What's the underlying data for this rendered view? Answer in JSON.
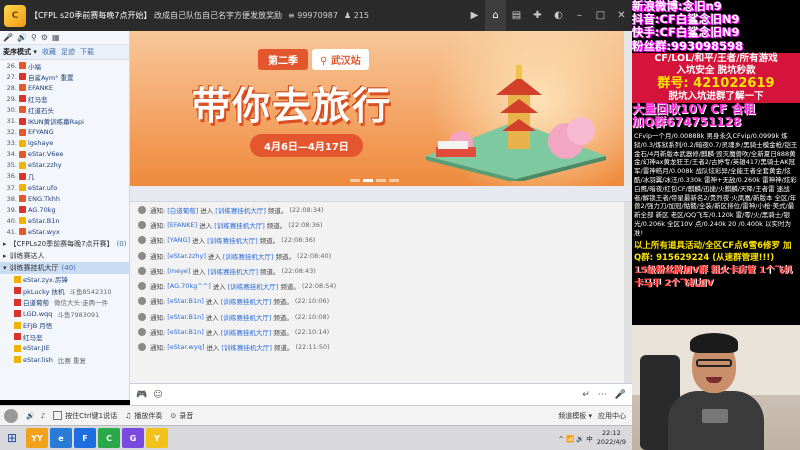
{
  "titlebar": {
    "logo": "C",
    "channel": "【CFPL s20季前赛每晚7点开始】",
    "announcement": "改成自己队伍自己名字方便发放奖励",
    "id_prefix": "≡",
    "id": "99970987",
    "users_icon": "♟",
    "users": "215",
    "icons": [
      "record-icon",
      "home-icon",
      "list-icon",
      "gamepad-icon",
      "skin-icon",
      "min-icon",
      "max-icon",
      "close-icon"
    ]
  },
  "leftpane": {
    "toolbar_label": "麦序模式 ▾",
    "tabs": [
      {
        "label": "频道",
        "selected": true
      },
      {
        "label": "收藏",
        "selected": false
      },
      {
        "label": "足迹",
        "selected": false
      },
      {
        "label": "下载",
        "selected": false
      }
    ],
    "users": [
      {
        "num": "26.",
        "name": "小福"
      },
      {
        "num": "27.",
        "name": "自鲨Aym° 重置"
      },
      {
        "num": "28.",
        "name": "EFANKE"
      },
      {
        "num": "29.",
        "name": "红马悲"
      },
      {
        "num": "30.",
        "name": "红道石头"
      },
      {
        "num": "31.",
        "name": "IKUN黄训练幕Rapi"
      },
      {
        "num": "32.",
        "name": "EFYANG"
      },
      {
        "num": "33.",
        "name": "lgshaye"
      },
      {
        "num": "34.",
        "name": "eStar.V6ee"
      },
      {
        "num": "35.",
        "name": "eStar.zzhy"
      },
      {
        "num": "36.",
        "name": "几"
      },
      {
        "num": "37.",
        "name": "eStar.ufo"
      },
      {
        "num": "38.",
        "name": "ENG.Tkhh"
      },
      {
        "num": "39.",
        "name": "AG.70kg"
      },
      {
        "num": "40.",
        "name": "eStar.B1n"
      },
      {
        "num": "41.",
        "name": "eStar.wyx"
      }
    ],
    "channels": [
      {
        "name": "【CFPLs20季前赛每晚7点开赛】",
        "count": "(0)",
        "highlight": false
      },
      {
        "name": "训练赛达人",
        "count": "",
        "highlight": false
      },
      {
        "name": "训练赛挂机大厅",
        "count": "(40)",
        "highlight": true
      }
    ],
    "subusers": [
      {
        "name": "eStar.zyx.厉锋",
        "extra": ""
      },
      {
        "name": "pkLucky 扶机",
        "extra": "斗鱼8542310"
      },
      {
        "name": "白道葡萄",
        "extra": "微信大头·走两一件"
      },
      {
        "name": "LGD.wqq",
        "extra": "斗鱼7983091"
      },
      {
        "name": "EFJB 月悟",
        "extra": ""
      },
      {
        "name": "红马悲",
        "extra": ""
      },
      {
        "name": "eStar.JIE",
        "extra": ""
      },
      {
        "name": "eStar.lish",
        "extra": "比赛 重复"
      }
    ]
  },
  "banner": {
    "season": "第二季",
    "city": "武汉站",
    "slogan": "带你去旅行",
    "dates": "4月6日—4月17日"
  },
  "chat": {
    "label": "通知:",
    "action": "进入",
    "room": "[训练赛挂机大厅]",
    "suffix": "频道。",
    "messages": [
      {
        "user": "[白道葡萄]",
        "time": "(22:08:34)"
      },
      {
        "user": "[EFANKE]",
        "time": "(22:08:36)"
      },
      {
        "user": "[YANG]",
        "time": "(22:08:36)"
      },
      {
        "user": "[eStar.zzhy]",
        "time": "(22:08:40)"
      },
      {
        "user": "[meye]",
        "time": "(22:08:43)"
      },
      {
        "user": "[AG.70kg^^]",
        "time": "(22:08:54)"
      },
      {
        "user": "[eStar.B1n]",
        "time": "(22:10:06)"
      },
      {
        "user": "[eStar.B1n]",
        "time": "(22:10:08)"
      },
      {
        "user": "[eStar.B1n]",
        "time": "(22:10:14)"
      },
      {
        "user": "[eStar.wyq]",
        "time": "(22:11:50)"
      }
    ]
  },
  "inputbar": {
    "placeholder": "",
    "send_icon": "↵"
  },
  "bottombar": {
    "items": [
      "按住Ctrl键1说话",
      "播放伴奏",
      "录音"
    ],
    "right": [
      "频道模板 ▾",
      "应用中心"
    ]
  },
  "taskbar": {
    "apps": [
      {
        "label": "YY",
        "color": "#f0a21b"
      },
      {
        "label": "e",
        "color": "#2a7bd4"
      },
      {
        "label": "F",
        "color": "#1f6ee0"
      },
      {
        "label": "C",
        "color": "#2aa84a"
      },
      {
        "label": "G",
        "color": "#7a4ae0"
      },
      {
        "label": "Y",
        "color": "#f0c21b"
      }
    ],
    "tray": "^ 📶 🔊 中",
    "time": "22:12",
    "date": "2022/4/9"
  },
  "overlay": {
    "weibo": "新浪微博:念旧n9",
    "douyin": "抖音:CF白鲨念旧N9",
    "kuaishou": "快手:CF白鲨念旧N9",
    "fans": "粉丝群:993098598",
    "games": "CF/LOL/和平/王者/所有游戏",
    "safe": "入坑安全 脱坑秒款",
    "group": "群号: 421022619",
    "hint": "脱坑入坑进群了解一下",
    "recycle1": "大量回收10V CF 含租",
    "recycle2": "加Q群674751128",
    "small": "CFvip一个月/0.00888k 男身永久CFvip/0.0999k 炼狱/0.3/炼狱系列/0.2/暗夜0.7/灵魂乡/黑骑士模金枪/铠王金石/4月新版本武器修/麒麟·毁灭魔兽吹/全新夏日888黄金/幻神ax黄龙狂王/王者2/古婷专/英雄417/黑骑士AK冠军/雷神皓月/0.008k 战队炫彩异/全能王者全套黄金/炫酷/冰羽翼/冰汪/0.330k 雷神+无敌/0.260k 雷神神/炫彩白鹰/暗夜/红包CF/麒麟/迅捷/火麒麟/天降/王者雷 速战者/解锁王者/帝星最新名2/贵烈夜·火凤凰/新版本 全区/年兽2/强力刀/加冠/骷髅/全装/新区排位/雷神/小枪·美式/最新全部 新区 老区/QQ飞车/0.120k 雷/零/火/黑骑士/银光/0.206k 全区10V 点/0.240k 20 /0.400k 以实时为准!",
    "yellow": "以上所有道具活动/全区CF点6雪6修罗 加Q群: 915629224 (从速群管理!!!)",
    "red": "15级粉丝牌加V群 粗火卡房管 1个飞机卡马甲 2个飞机加V"
  }
}
